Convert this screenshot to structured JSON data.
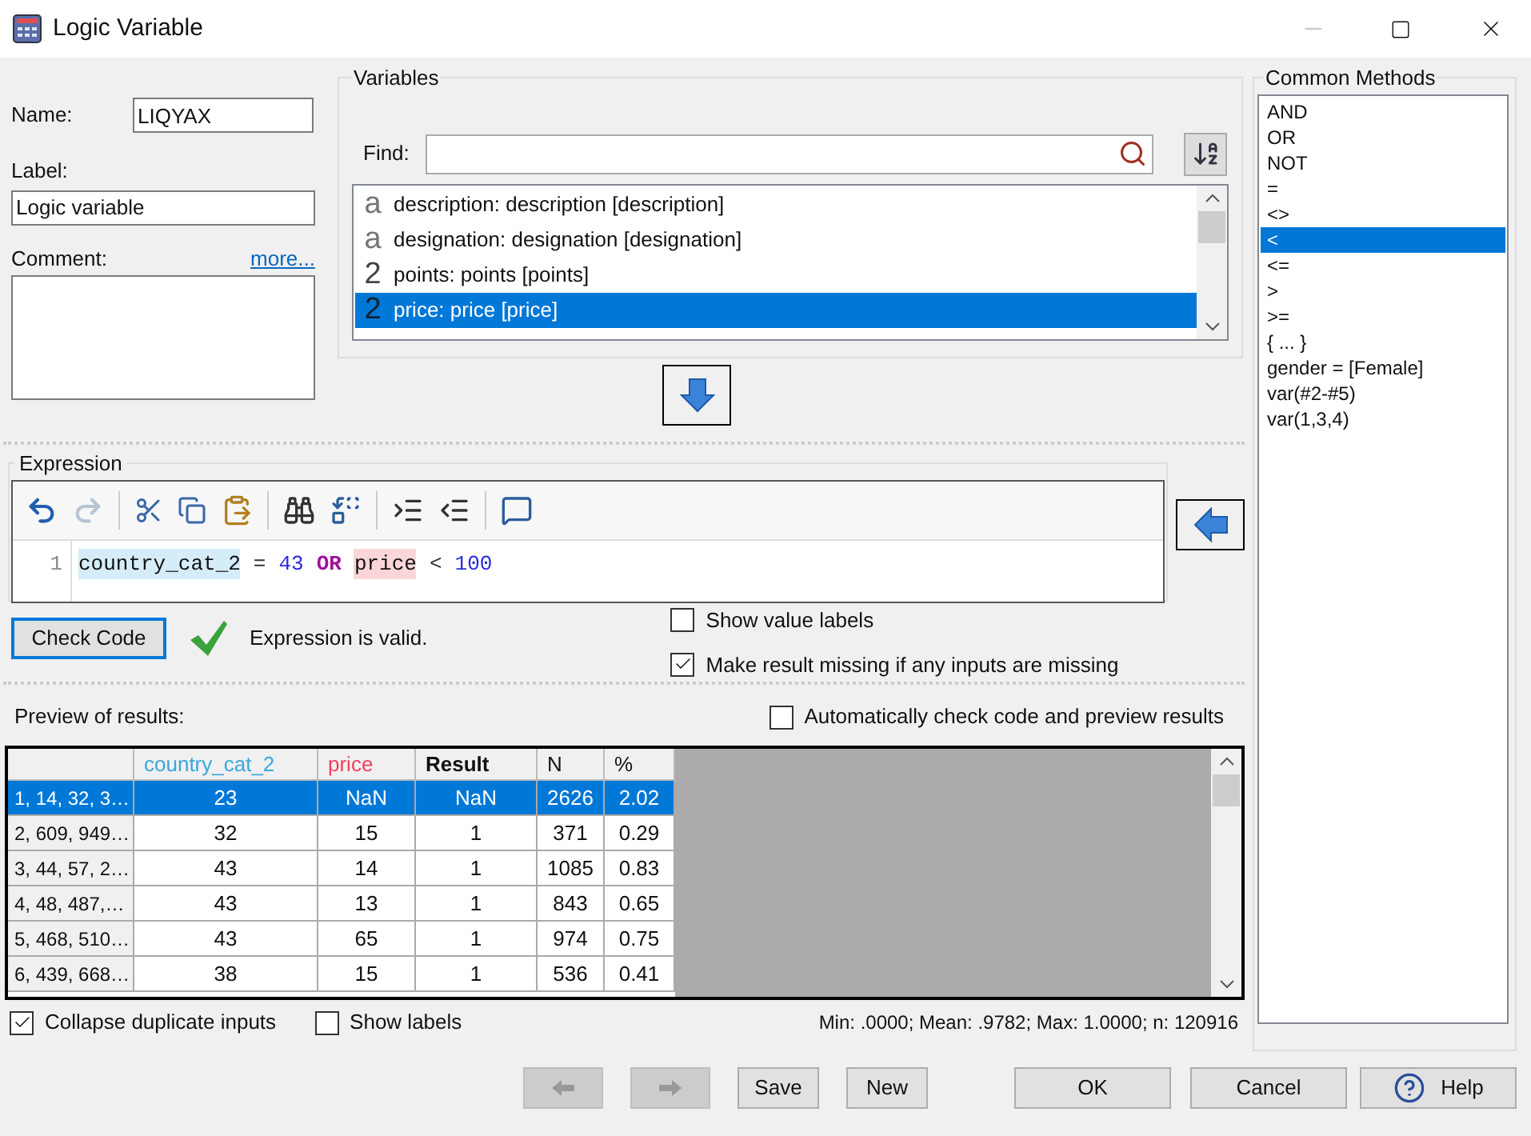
{
  "window": {
    "title": "Logic Variable"
  },
  "form": {
    "name": {
      "label": "Name:",
      "value": "LIQYAX"
    },
    "label_field": {
      "label": "Label:",
      "value": "Logic variable"
    },
    "comment": {
      "label": "Comment:",
      "link": "more..."
    }
  },
  "variables": {
    "title": "Variables",
    "find_label": "Find:",
    "items": [
      {
        "kind": "text",
        "glyph": "a",
        "label": "description: description [description]",
        "selected": false
      },
      {
        "kind": "text",
        "glyph": "a",
        "label": "designation: designation [designation]",
        "selected": false
      },
      {
        "kind": "numeric",
        "glyph": "2",
        "label": "points: points [points]",
        "selected": false
      },
      {
        "kind": "numeric",
        "glyph": "2",
        "label": "price: price [price]",
        "selected": true
      }
    ]
  },
  "expression": {
    "title": "Expression",
    "line_number": "1",
    "tokens": [
      {
        "kind": "variable",
        "text": "country_cat_2",
        "color": "#d4edf8"
      },
      {
        "kind": "operator",
        "text": "="
      },
      {
        "kind": "number",
        "text": "43"
      },
      {
        "kind": "keyword",
        "text": "OR"
      },
      {
        "kind": "variable",
        "text": "price",
        "color": "#fbd6d9"
      },
      {
        "kind": "operator",
        "text": "<"
      },
      {
        "kind": "number",
        "text": "100"
      }
    ]
  },
  "check": {
    "button": "Check Code",
    "valid": true,
    "message": "Expression is valid."
  },
  "options": [
    {
      "label": "Show value labels",
      "checked": false
    },
    {
      "label": "Make result missing if any inputs are missing",
      "checked": true
    }
  ],
  "preview": {
    "title": "Preview of results:",
    "auto_check": {
      "label": "Automatically check code and preview results",
      "checked": false
    },
    "columns": [
      {
        "kind": "input",
        "label": "country_cat_2",
        "color": "#3aa6dd"
      },
      {
        "kind": "input",
        "label": "price",
        "color": "#f0405c"
      },
      {
        "kind": "result",
        "label": "Result"
      },
      {
        "kind": "stat",
        "label": "N"
      },
      {
        "kind": "stat",
        "label": "%"
      }
    ],
    "rows": [
      {
        "label": "1, 14, 32, 3…",
        "cells": [
          "23",
          "NaN",
          "NaN",
          "2626",
          "2.02"
        ],
        "selected": true
      },
      {
        "label": "2, 609, 949…",
        "cells": [
          "32",
          "15",
          "1",
          "371",
          "0.29"
        ],
        "selected": false
      },
      {
        "label": "3, 44, 57, 2…",
        "cells": [
          "43",
          "14",
          "1",
          "1085",
          "0.83"
        ],
        "selected": false
      },
      {
        "label": "4, 48, 487,…",
        "cells": [
          "43",
          "13",
          "1",
          "843",
          "0.65"
        ],
        "selected": false
      },
      {
        "label": "5, 468, 510…",
        "cells": [
          "43",
          "65",
          "1",
          "974",
          "0.75"
        ],
        "selected": false
      },
      {
        "label": "6, 439, 668…",
        "cells": [
          "38",
          "15",
          "1",
          "536",
          "0.41"
        ],
        "selected": false
      }
    ]
  },
  "footer": {
    "options": [
      {
        "label": "Collapse duplicate inputs",
        "checked": true
      },
      {
        "label": "Show labels",
        "checked": false
      }
    ],
    "stats": "Min: .0000; Mean: .9782; Max: 1.0000; n: 120916"
  },
  "buttons": [
    {
      "kind": "back",
      "disabled": true
    },
    {
      "kind": "forward",
      "disabled": true
    },
    {
      "kind": "text",
      "label": "Save"
    },
    {
      "kind": "text",
      "label": "New"
    },
    {
      "kind": "gap"
    },
    {
      "kind": "text",
      "label": "OK"
    },
    {
      "kind": "text",
      "label": "Cancel"
    },
    {
      "kind": "help",
      "label": "Help"
    }
  ],
  "common_methods": {
    "title": "Common Methods",
    "items": [
      {
        "label": "AND",
        "selected": false
      },
      {
        "label": "OR",
        "selected": false
      },
      {
        "label": "NOT",
        "selected": false
      },
      {
        "label": "=",
        "selected": false
      },
      {
        "label": "<>",
        "selected": false
      },
      {
        "label": "<",
        "selected": true
      },
      {
        "label": "<=",
        "selected": false
      },
      {
        "label": ">",
        "selected": false
      },
      {
        "label": ">=",
        "selected": false
      },
      {
        "label": "{ ... }",
        "selected": false
      },
      {
        "label": "gender = [Female]",
        "selected": false
      },
      {
        "label": "var(#2-#5)",
        "selected": false
      },
      {
        "label": "var(1,3,4)",
        "selected": false
      }
    ]
  }
}
